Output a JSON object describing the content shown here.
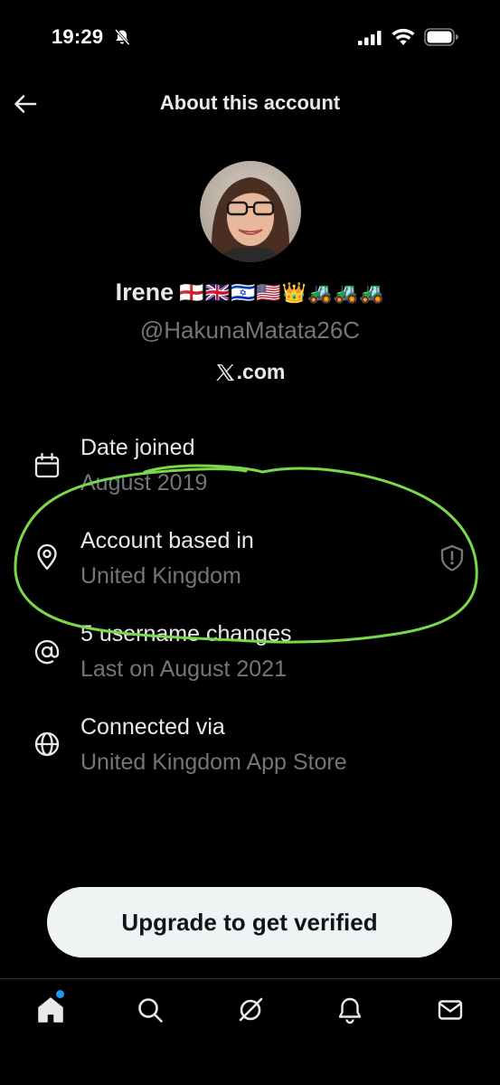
{
  "status_bar": {
    "time": "19:29"
  },
  "header": {
    "title": "About this account",
    "back_icon": "arrow-left-icon"
  },
  "profile": {
    "name": "Irene",
    "emoji": "🏴󠁧󠁢󠁥󠁮󠁧󠁿🇬🇧🇮🇱🇺🇸👑🚜🚜🚜",
    "handle": "@HakunaMatata26C",
    "site": ".com"
  },
  "info_items": [
    {
      "icon": "calendar-icon",
      "title": "Date joined",
      "value": "August 2019"
    },
    {
      "icon": "location-pin-icon",
      "title": "Account based in",
      "value": "United Kingdom"
    },
    {
      "icon": "at-sign-icon",
      "title": "5 username changes",
      "value": "Last on August 2021"
    },
    {
      "icon": "globe-icon",
      "title": "Connected via",
      "value": "United Kingdom App Store"
    }
  ],
  "upgrade_button": {
    "label": "Upgrade to get verified"
  },
  "bottom_nav": [
    {
      "icon": "home-icon"
    },
    {
      "icon": "search-icon"
    },
    {
      "icon": "grok-icon"
    },
    {
      "icon": "bell-icon"
    },
    {
      "icon": "mail-icon"
    }
  ],
  "colors": {
    "background": "#000000",
    "primary_text": "#e7e9ea",
    "secondary_text": "#71767b",
    "highlight_ring": "#7bd84a",
    "notification_dot": "#1d9bf0",
    "button_bg": "#eff3f4"
  }
}
